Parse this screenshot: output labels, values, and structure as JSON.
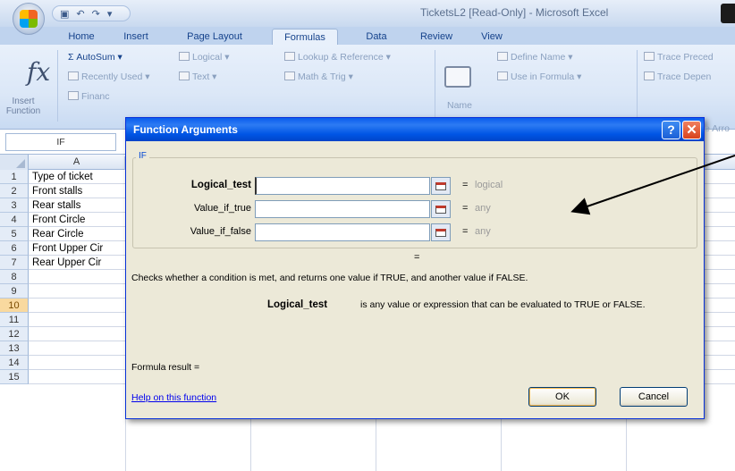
{
  "window": {
    "title": "TicketsL2  [Read-Only] - Microsoft Excel",
    "qat_icons": [
      "save-icon",
      "undo-icon",
      "redo-icon"
    ]
  },
  "tabs": [
    "Home",
    "Insert",
    "Page Layout",
    "Formulas",
    "Data",
    "Review",
    "View"
  ],
  "active_tab": "Formulas",
  "ribbon": {
    "insert_function": "Insert Function",
    "autosum": "Σ AutoSum ▾",
    "recently_used": "Recently Used ▾",
    "financial": "Financ",
    "logical": "Logical ▾",
    "text": "Text ▾",
    "lookup_reference": "Lookup & Reference ▾",
    "math_trig": "Math & Trig ▾",
    "name_manager": "Name",
    "define_name": "Define Name ▾",
    "use_in_formula": "Use in Formula ▾",
    "trace_precedents": "Trace Preced",
    "trace_dependents": "Trace Depen",
    "remove_arrows": "e Arro"
  },
  "name_box": "IF",
  "sheet": {
    "columns": [
      "A"
    ],
    "rows": [
      "1",
      "2",
      "3",
      "4",
      "5",
      "6",
      "7",
      "8",
      "9",
      "10",
      "11",
      "12",
      "13",
      "14",
      "15"
    ],
    "selected_row": "10",
    "col_a_values": [
      "Type of ticket",
      "Front stalls",
      "Rear stalls",
      "Front Circle",
      "Rear Circle",
      "Front Upper Cir",
      "Rear Upper Cir"
    ]
  },
  "dialog": {
    "title": "Function Arguments",
    "function_name": "IF",
    "args": [
      {
        "label": "Logical_test",
        "value": "",
        "result": "logical"
      },
      {
        "label": "Value_if_true",
        "value": "",
        "result": "any"
      },
      {
        "label": "Value_if_false",
        "value": "",
        "result": "any"
      }
    ],
    "eq": "=",
    "function_description": "Checks whether a condition is met, and returns one value if TRUE, and another value if FALSE.",
    "arg_description_name": "Logical_test",
    "arg_description_text": "is any value or expression that can be evaluated to TRUE or FALSE.",
    "formula_result": "Formula result =",
    "help_link": "Help on this function",
    "ok": "OK",
    "cancel": "Cancel",
    "help_button": "?",
    "close_button": "✕"
  }
}
